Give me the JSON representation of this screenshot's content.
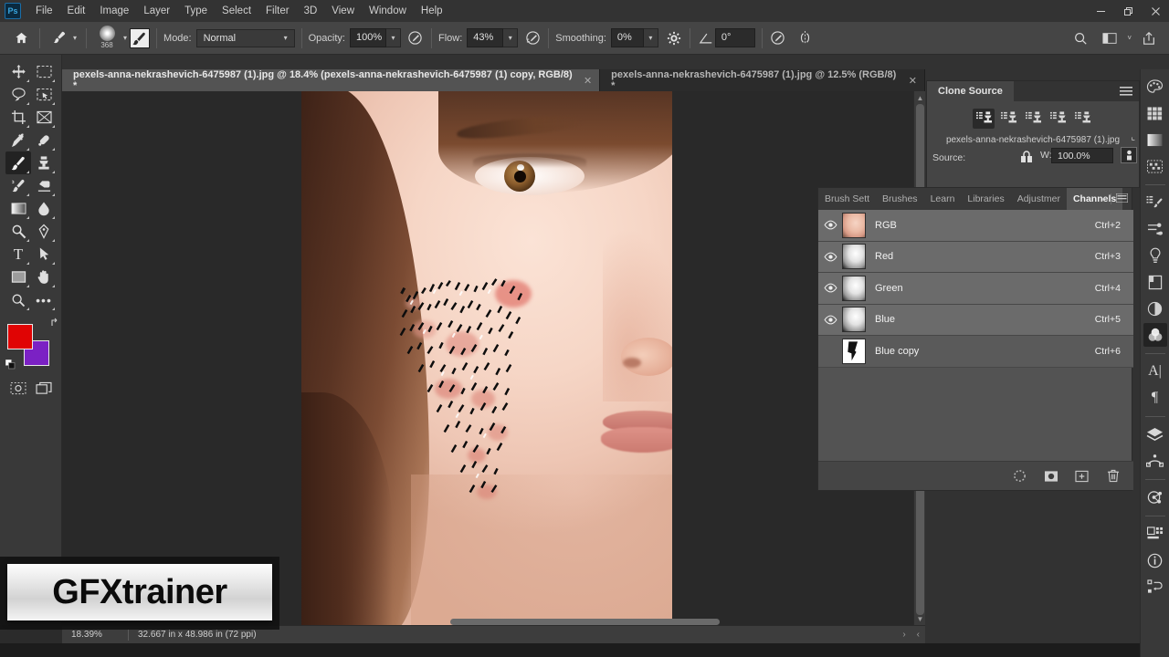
{
  "app": {
    "title": "Adobe Photoshop",
    "logo_text": "Ps"
  },
  "menubar": {
    "items": [
      "File",
      "Edit",
      "Image",
      "Layer",
      "Type",
      "Select",
      "Filter",
      "3D",
      "View",
      "Window",
      "Help"
    ],
    "window_controls": {
      "minimize": "—",
      "maximize": "❐",
      "close": "✕"
    }
  },
  "options_bar": {
    "home_icon": "home-icon",
    "tool_icon": "brush-tool-icon",
    "brush_size": "368",
    "brush_preset_icon": "brush-preset-icon",
    "brush_panel_icon": "brush-settings-icon",
    "mode_label": "Mode:",
    "mode_value": "Normal",
    "opacity_label": "Opacity:",
    "opacity_value": "100%",
    "opacity_pressure_icon": "pressure-opacity-icon",
    "flow_label": "Flow:",
    "flow_value": "43%",
    "airbrush_icon": "airbrush-icon",
    "smoothing_label": "Smoothing:",
    "smoothing_value": "0%",
    "smoothing_options_icon": "gear-icon",
    "angle_icon": "angle-icon",
    "angle_value": "0°",
    "pressure_size_icon": "pressure-size-icon",
    "symmetry_icon": "symmetry-icon",
    "search_icon": "search-icon",
    "workspace_icon": "workspace-icon",
    "workspace_caret": "˅",
    "share_icon": "share-icon"
  },
  "tabs": [
    {
      "label": "pexels-anna-nekrashevich-6475987 (1).jpg @ 18.4% (pexels-anna-nekrashevich-6475987 (1) copy, RGB/8) *",
      "active": true,
      "close": "✕"
    },
    {
      "label": "pexels-anna-nekrashevich-6475987 (1).jpg @ 12.5% (RGB/8) *",
      "active": false,
      "close": "✕"
    }
  ],
  "toolbar": {
    "tools": [
      {
        "name": "move-tool",
        "glyph": "✥",
        "selected": false
      },
      {
        "name": "rectangular-marquee-tool",
        "glyph": "⬚",
        "selected": false
      },
      {
        "name": "lasso-tool",
        "glyph": "⬯",
        "selected": false
      },
      {
        "name": "object-selection-tool",
        "glyph": "⬚",
        "selected": false
      },
      {
        "name": "crop-tool",
        "glyph": "⌙",
        "selected": false
      },
      {
        "name": "frame-tool",
        "glyph": "☒",
        "selected": false
      },
      {
        "name": "eyedropper-tool",
        "glyph": "✒",
        "selected": false
      },
      {
        "name": "spot-healing-brush-tool",
        "glyph": "✎",
        "selected": false
      },
      {
        "name": "brush-tool",
        "glyph": "✐",
        "selected": true
      },
      {
        "name": "clone-stamp-tool",
        "glyph": "⚑",
        "selected": false
      },
      {
        "name": "history-brush-tool",
        "glyph": "✒",
        "selected": false
      },
      {
        "name": "eraser-tool",
        "glyph": "◢",
        "selected": false
      },
      {
        "name": "gradient-tool",
        "glyph": "▧",
        "selected": false
      },
      {
        "name": "blur-tool",
        "glyph": "◖",
        "selected": false
      },
      {
        "name": "dodge-tool",
        "glyph": "⚲",
        "selected": false
      },
      {
        "name": "pen-tool",
        "glyph": "✒",
        "selected": false
      },
      {
        "name": "horizontal-type-tool",
        "glyph": "T",
        "selected": false
      },
      {
        "name": "path-selection-tool",
        "glyph": "➤",
        "selected": false
      },
      {
        "name": "rectangle-tool",
        "glyph": "▭",
        "selected": false
      },
      {
        "name": "hand-tool",
        "glyph": "✋",
        "selected": false
      },
      {
        "name": "zoom-tool",
        "glyph": "⚲",
        "selected": false
      },
      {
        "name": "edit-toolbar-button",
        "glyph": "•••",
        "selected": false
      }
    ],
    "foreground_color": "#e00404",
    "background_color": "#7b21c4",
    "swap_colors_icon": "swap-colors-icon",
    "default_colors_icon": "default-colors-icon",
    "quick_mask_icon": "quick-mask-icon",
    "screen_mode_icon": "screen-mode-icon"
  },
  "clone_source": {
    "title": "Clone Source",
    "menu_icon": "panel-menu-icon",
    "stamps": [
      {
        "name": "clone-source-1",
        "selected": true
      },
      {
        "name": "clone-source-2",
        "selected": false
      },
      {
        "name": "clone-source-3",
        "selected": false
      },
      {
        "name": "clone-source-4",
        "selected": false
      },
      {
        "name": "clone-source-5",
        "selected": false
      }
    ],
    "filename": "pexels-anna-nekrashevich-6475987 (1).jpg",
    "source_label": "Source:",
    "lock_icon": "link-lock-icon",
    "width_label": "W:",
    "width_value": "100.0%",
    "reset_icon": "reset-transform-icon",
    "clip_icon": "clipped-source-icon"
  },
  "panel_tabs": {
    "items": [
      {
        "label": "Brush Sett",
        "name": "tab-brush-settings",
        "active": false
      },
      {
        "label": "Brushes",
        "name": "tab-brushes",
        "active": false
      },
      {
        "label": "Learn",
        "name": "tab-learn",
        "active": false
      },
      {
        "label": "Libraries",
        "name": "tab-libraries",
        "active": false
      },
      {
        "label": "Adjustmer",
        "name": "tab-adjustments",
        "active": false
      },
      {
        "label": "Channels",
        "name": "tab-channels",
        "active": true
      }
    ],
    "expand_icon": "»",
    "menu_icon": "panel-menu-icon"
  },
  "channels": {
    "rows": [
      {
        "name": "RGB",
        "shortcut": "Ctrl+2",
        "visible": true,
        "selected": false,
        "thumb": "rgb"
      },
      {
        "name": "Red",
        "shortcut": "Ctrl+3",
        "visible": true,
        "selected": false,
        "thumb": "gray"
      },
      {
        "name": "Green",
        "shortcut": "Ctrl+4",
        "visible": true,
        "selected": false,
        "thumb": "gray"
      },
      {
        "name": "Blue",
        "shortcut": "Ctrl+5",
        "visible": true,
        "selected": false,
        "thumb": "gray"
      },
      {
        "name": "Blue copy",
        "shortcut": "Ctrl+6",
        "visible": false,
        "selected": true,
        "thumb": "bluecopy"
      }
    ],
    "footer_buttons": [
      {
        "name": "load-channel-as-selection-button",
        "icon": "marching-ants-icon"
      },
      {
        "name": "save-selection-as-channel-button",
        "icon": "mask-icon"
      },
      {
        "name": "create-new-channel-button",
        "icon": "plus-square-icon"
      },
      {
        "name": "delete-channel-button",
        "icon": "trash-icon"
      }
    ]
  },
  "icon_dock": {
    "groups": [
      [
        {
          "name": "color-panel-icon"
        },
        {
          "name": "swatches-panel-icon"
        },
        {
          "name": "gradients-panel-icon"
        },
        {
          "name": "patterns-panel-icon"
        }
      ],
      [
        {
          "name": "brush-settings-panel-icon"
        },
        {
          "name": "brushes-panel-icon"
        },
        {
          "name": "learn-panel-icon"
        },
        {
          "name": "libraries-panel-icon"
        },
        {
          "name": "adjustments-panel-icon"
        },
        {
          "name": "channels-panel-icon",
          "selected": true
        }
      ],
      [
        {
          "name": "character-panel-icon"
        },
        {
          "name": "paragraph-panel-icon"
        }
      ],
      [
        {
          "name": "layers-panel-icon"
        },
        {
          "name": "paths-panel-icon"
        }
      ],
      [
        {
          "name": "clone-source-panel-icon"
        }
      ],
      [
        {
          "name": "properties-panel-icon"
        },
        {
          "name": "info-panel-icon"
        },
        {
          "name": "history-panel-icon"
        }
      ]
    ]
  },
  "status_bar": {
    "zoom": "18.39%",
    "dimensions": "32.667 in x 48.986 in (72 ppi)",
    "next_arrow": "›",
    "prev_arrow": "‹"
  },
  "watermark": {
    "text": "GFXtrainer"
  },
  "colors": {
    "menubar_bg": "#333333",
    "options_bg": "#454545",
    "panel_bg": "#535353",
    "canvas_bg": "#292929",
    "accent_blue": "#3aa7e0"
  }
}
